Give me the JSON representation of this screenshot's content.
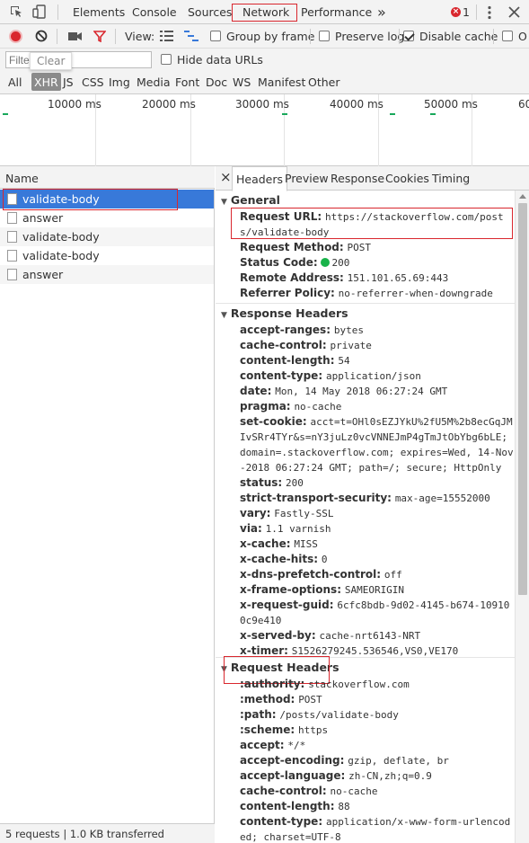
{
  "main_tabs": [
    "Elements",
    "Console",
    "Sources",
    "Network",
    "Performance"
  ],
  "more_tabs_glyph": "»",
  "error_count": "1",
  "toolbar": {
    "view_label": "View:",
    "group_by_frame": "Group by frame",
    "preserve_log": "Preserve log",
    "disable_cache": "Disable cache",
    "offline_partial": "O"
  },
  "filter": {
    "placeholder": "Filter",
    "tooltip": "Clear",
    "hide_data_urls": "Hide data URLs",
    "types": [
      "All",
      "XHR",
      "JS",
      "CSS",
      "Img",
      "Media",
      "Font",
      "Doc",
      "WS",
      "Manifest",
      "Other"
    ],
    "active_type": "XHR"
  },
  "timeline": {
    "labels": [
      "10000 ms",
      "20000 ms",
      "30000 ms",
      "40000 ms",
      "50000 ms",
      "60"
    ]
  },
  "requests": {
    "header": "Name",
    "items": [
      {
        "name": "validate-body"
      },
      {
        "name": "answer"
      },
      {
        "name": "validate-body"
      },
      {
        "name": "validate-body"
      },
      {
        "name": "answer"
      }
    ],
    "status": "5 requests | 1.0 KB transferred"
  },
  "detail_tabs": [
    "Headers",
    "Preview",
    "Response",
    "Cookies",
    "Timing"
  ],
  "close_glyph": "×",
  "general": {
    "title": "General",
    "request_url_label": "Request URL:",
    "request_url": "https://stackoverflow.com/posts/validate-body",
    "request_method_label": "Request Method:",
    "request_method": "POST",
    "status_code_label": "Status Code:",
    "status_code": "200",
    "remote_address_label": "Remote Address:",
    "remote_address": "151.101.65.69:443",
    "referrer_policy_label": "Referrer Policy:",
    "referrer_policy": "no-referrer-when-downgrade"
  },
  "response_headers": {
    "title": "Response Headers",
    "items": [
      {
        "k": "accept-ranges:",
        "v": "bytes"
      },
      {
        "k": "cache-control:",
        "v": "private"
      },
      {
        "k": "content-length:",
        "v": "54"
      },
      {
        "k": "content-type:",
        "v": "application/json"
      },
      {
        "k": "date:",
        "v": "Mon, 14 May 2018 06:27:24 GMT"
      },
      {
        "k": "pragma:",
        "v": "no-cache"
      },
      {
        "k": "set-cookie:",
        "v": "acct=t=OHl0sEZJYkU%2fU5M%2b8ecGqJMIvSRr4TYr&s=nY3juLz0vcVNNEJmP4gTmJtObYbg6bLE; domain=.stackoverflow.com; expires=Wed, 14-Nov-2018 06:27:24 GMT; path=/; secure; HttpOnly"
      },
      {
        "k": "status:",
        "v": "200"
      },
      {
        "k": "strict-transport-security:",
        "v": "max-age=15552000"
      },
      {
        "k": "vary:",
        "v": "Fastly-SSL"
      },
      {
        "k": "via:",
        "v": "1.1 varnish"
      },
      {
        "k": "x-cache:",
        "v": "MISS"
      },
      {
        "k": "x-cache-hits:",
        "v": "0"
      },
      {
        "k": "x-dns-prefetch-control:",
        "v": "off"
      },
      {
        "k": "x-frame-options:",
        "v": "SAMEORIGIN"
      },
      {
        "k": "x-request-guid:",
        "v": "6cfc8bdb-9d02-4145-b674-109100c9e410"
      },
      {
        "k": "x-served-by:",
        "v": "cache-nrt6143-NRT"
      },
      {
        "k": "x-timer:",
        "v": "S1526279245.536546,VS0,VE170"
      }
    ]
  },
  "request_headers": {
    "title": "Request Headers",
    "items": [
      {
        "k": ":authority:",
        "v": "stackoverflow.com"
      },
      {
        "k": ":method:",
        "v": "POST"
      },
      {
        "k": ":path:",
        "v": "/posts/validate-body"
      },
      {
        "k": ":scheme:",
        "v": "https"
      },
      {
        "k": "accept:",
        "v": "*/*"
      },
      {
        "k": "accept-encoding:",
        "v": "gzip, deflate, br"
      },
      {
        "k": "accept-language:",
        "v": "zh-CN,zh;q=0.9"
      },
      {
        "k": "cache-control:",
        "v": "no-cache"
      },
      {
        "k": "content-length:",
        "v": "88"
      },
      {
        "k": "content-type:",
        "v": "application/x-www-form-urlencoded; charset=UTF-8"
      }
    ]
  },
  "colors": {
    "accent_blue": "#3879d9",
    "record_red": "#d9272e",
    "highlight_box": "#d9272e",
    "status_green": "#19b34a"
  }
}
